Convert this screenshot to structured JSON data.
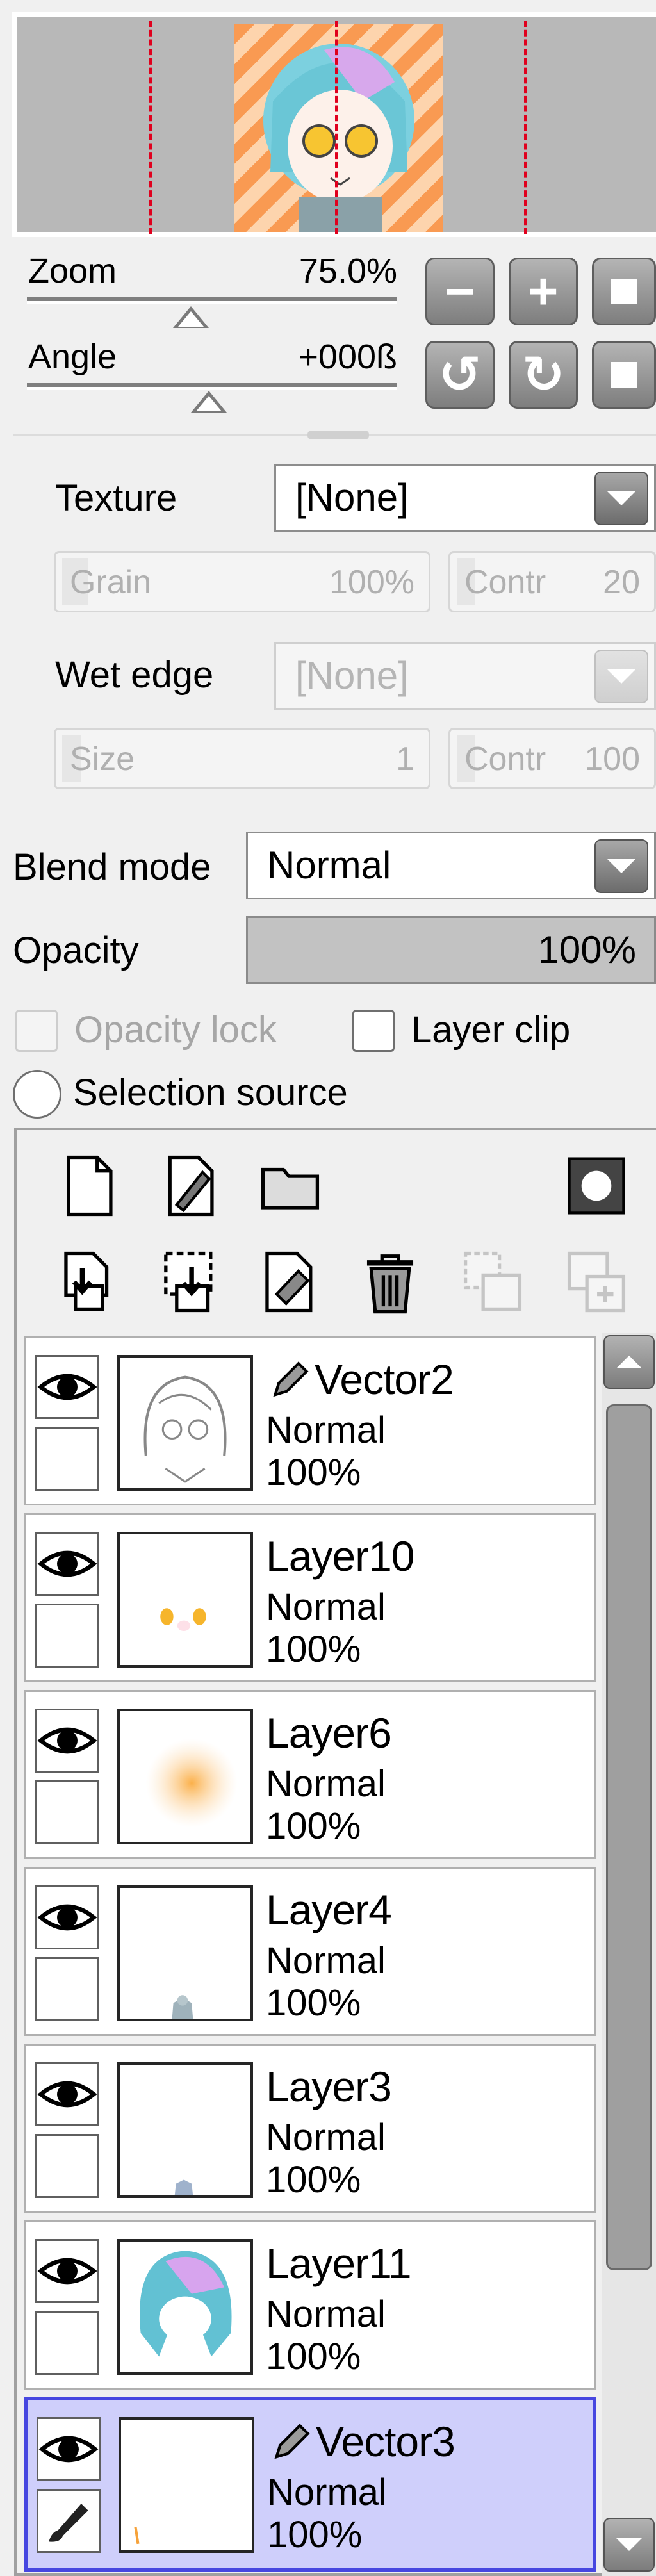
{
  "navigator": {
    "zoom": {
      "label": "Zoom",
      "value": "75.0%"
    },
    "angle": {
      "label": "Angle",
      "value": "+000ß"
    },
    "buttons": {
      "zoom_out": "−",
      "zoom_in": "+",
      "rotate_left": "↺",
      "rotate_right": "↻"
    }
  },
  "brush": {
    "texture": {
      "label": "Texture",
      "value": "[None]"
    },
    "grain": {
      "label": "Grain",
      "value": "100%"
    },
    "texture_contrast": {
      "label": "Contr",
      "value": "20"
    },
    "wet_edge": {
      "label": "Wet edge",
      "value": "[None]"
    },
    "size": {
      "label": "Size",
      "value": "1"
    },
    "wet_contrast": {
      "label": "Contr",
      "value": "100"
    }
  },
  "layer_props": {
    "blend_mode": {
      "label": "Blend mode",
      "value": "Normal"
    },
    "opacity": {
      "label": "Opacity",
      "value": "100%",
      "level": 1.0
    },
    "opacity_lock": "Opacity lock",
    "layer_clip": "Layer clip",
    "selection_source": "Selection source"
  },
  "layer_toolbar": {
    "row1": [
      "new-layer-icon",
      "new-linework-layer-icon",
      "new-folder-icon",
      "layer-mask-icon"
    ],
    "row2": [
      "transfer-down-icon",
      "merge-down-icon",
      "clear-layer-icon",
      "delete-layer-icon",
      "merge-selected-icon",
      "merge-visible-icon"
    ]
  },
  "layers": [
    {
      "name": "Vector2",
      "mode": "Normal",
      "opacity": "100%",
      "vector": true,
      "selected": false,
      "thumb": "lineart"
    },
    {
      "name": "Layer10",
      "mode": "Normal",
      "opacity": "100%",
      "vector": false,
      "selected": false,
      "thumb": "eyes"
    },
    {
      "name": "Layer6",
      "mode": "Normal",
      "opacity": "100%",
      "vector": false,
      "selected": false,
      "thumb": "orange-blob"
    },
    {
      "name": "Layer4",
      "mode": "Normal",
      "opacity": "100%",
      "vector": false,
      "selected": false,
      "thumb": "small-figure"
    },
    {
      "name": "Layer3",
      "mode": "Normal",
      "opacity": "100%",
      "vector": false,
      "selected": false,
      "thumb": "small-figure-2"
    },
    {
      "name": "Layer11",
      "mode": "Normal",
      "opacity": "100%",
      "vector": false,
      "selected": false,
      "thumb": "hair"
    },
    {
      "name": "Vector3",
      "mode": "Normal",
      "opacity": "100%",
      "vector": true,
      "selected": true,
      "thumb": "stroke"
    }
  ]
}
